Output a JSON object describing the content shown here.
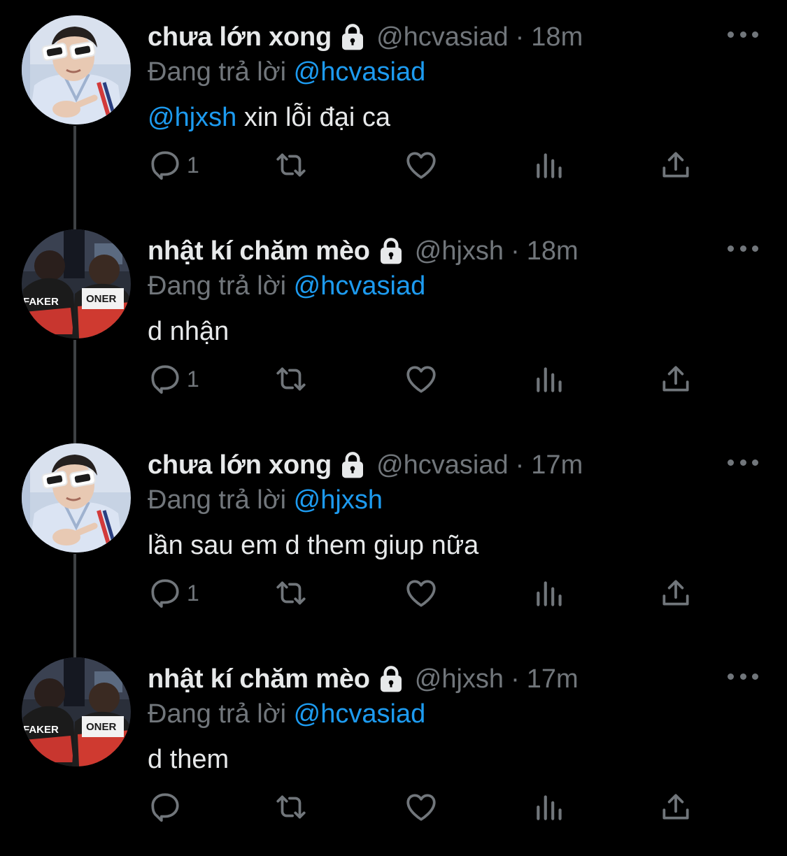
{
  "colors": {
    "background": "#000000",
    "text_primary": "#e7e9ea",
    "text_secondary": "#71767b",
    "accent": "#1d9bf0",
    "thread_line": "#3e4144"
  },
  "tweets": [
    {
      "display_name": "chưa lớn xong",
      "lock_icon": "lock-icon",
      "handle": "@hcvasiad",
      "separator": "·",
      "time": "18m",
      "reply_prefix": "Đang trả lời",
      "reply_to": "@hcvasiad",
      "text_mention": "@hjxsh",
      "text": " xin lỗi đại ca",
      "reply_count": "1",
      "avatar": "avatar-white-sunglasses"
    },
    {
      "display_name": "nhật kí chăm mèo",
      "lock_icon": "lock-icon",
      "handle": "@hjxsh",
      "separator": "·",
      "time": "18m",
      "reply_prefix": "Đang trả lời",
      "reply_to": "@hcvasiad",
      "text_mention": "",
      "text": "d nhận",
      "reply_count": "1",
      "avatar": "avatar-faker-oner",
      "avatar_labels": [
        "FAKER",
        "ONER"
      ]
    },
    {
      "display_name": "chưa lớn xong",
      "lock_icon": "lock-icon",
      "handle": "@hcvasiad",
      "separator": "·",
      "time": "17m",
      "reply_prefix": "Đang trả lời",
      "reply_to": "@hjxsh",
      "text_mention": "",
      "text": "lần sau em d them giup nữa",
      "reply_count": "1",
      "avatar": "avatar-white-sunglasses"
    },
    {
      "display_name": "nhật kí chăm mèo",
      "lock_icon": "lock-icon",
      "handle": "@hjxsh",
      "separator": "·",
      "time": "17m",
      "reply_prefix": "Đang trả lời",
      "reply_to": "@hcvasiad",
      "text_mention": "",
      "text": "d them",
      "reply_count": "",
      "avatar": "avatar-faker-oner",
      "avatar_labels": [
        "FAKER",
        "ONER"
      ]
    }
  ],
  "action_icons": [
    "reply-icon",
    "retweet-icon",
    "like-icon",
    "views-icon",
    "share-icon"
  ]
}
